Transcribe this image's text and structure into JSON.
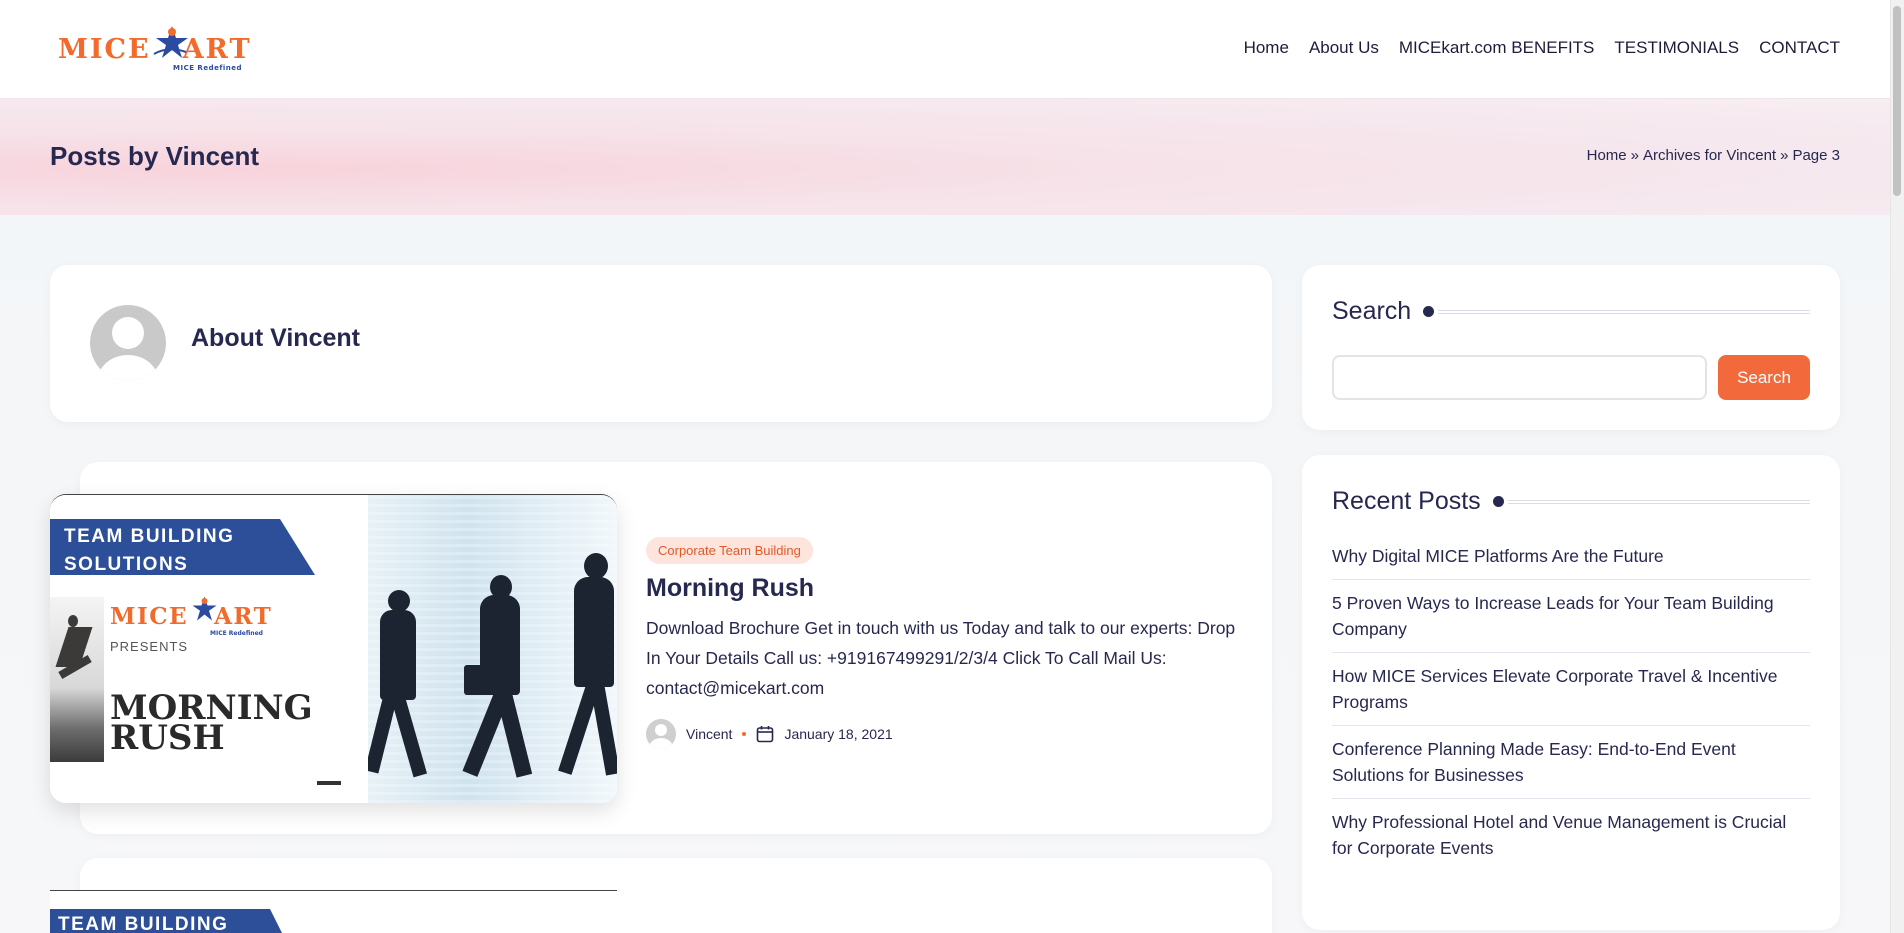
{
  "header": {
    "logo": {
      "wordmark_left": "MICE",
      "wordmark_right": "ART",
      "tagline": "MICE Redefined"
    },
    "nav": [
      {
        "label": "Home"
      },
      {
        "label": "About Us"
      },
      {
        "label": "MICEkart.com BENEFITS"
      },
      {
        "label": "TESTIMONIALS"
      },
      {
        "label": "CONTACT"
      }
    ]
  },
  "page_title": "Posts by Vincent",
  "breadcrumb": {
    "home": "Home",
    "separator": "»",
    "archive": "Archives for Vincent",
    "page": "Page 3"
  },
  "about": {
    "title": "About Vincent"
  },
  "posts": [
    {
      "thumbnail": {
        "banner": [
          "TEAM BUILDING",
          "SOLUTIONS"
        ],
        "logo_left": "MICE",
        "logo_right": "ART",
        "logo_tag": "MICE Redefined",
        "presents": "PRESENTS",
        "title_lines": [
          "MORNING",
          "RUSH"
        ]
      },
      "category": "Corporate Team Building",
      "title": "Morning Rush",
      "excerpt": "Download Brochure Get in touch with us Today and talk to our experts: Drop In Your Details   Call us: +919167499291/2/3/4 Click To Call Mail Us: contact@micekart.com",
      "author": "Vincent",
      "date": "January 18, 2021"
    },
    {
      "thumbnail": {
        "banner": [
          "TEAM BUILDING"
        ]
      }
    }
  ],
  "sidebar": {
    "search": {
      "title": "Search",
      "placeholder": "",
      "button": "Search"
    },
    "recent": {
      "title": "Recent Posts",
      "items": [
        "Why Digital MICE Platforms Are the Future",
        "5 Proven Ways to Increase Leads for Your Team Building Company",
        "How MICE Services Elevate Corporate Travel & Incentive Programs",
        "Conference Planning Made Easy: End-to-End Event Solutions for Businesses",
        "Why Professional Hotel and Venue Management is Crucial for Corporate Events"
      ]
    }
  },
  "colors": {
    "brand_orange": "#f26a2c",
    "brand_blue": "#2d4f9a",
    "text_dark": "#27284f",
    "pill_bg": "#fde4dd"
  },
  "icons": {
    "calendar": "calendar-icon",
    "avatar": "user-avatar-icon",
    "star": "star-person-icon"
  }
}
